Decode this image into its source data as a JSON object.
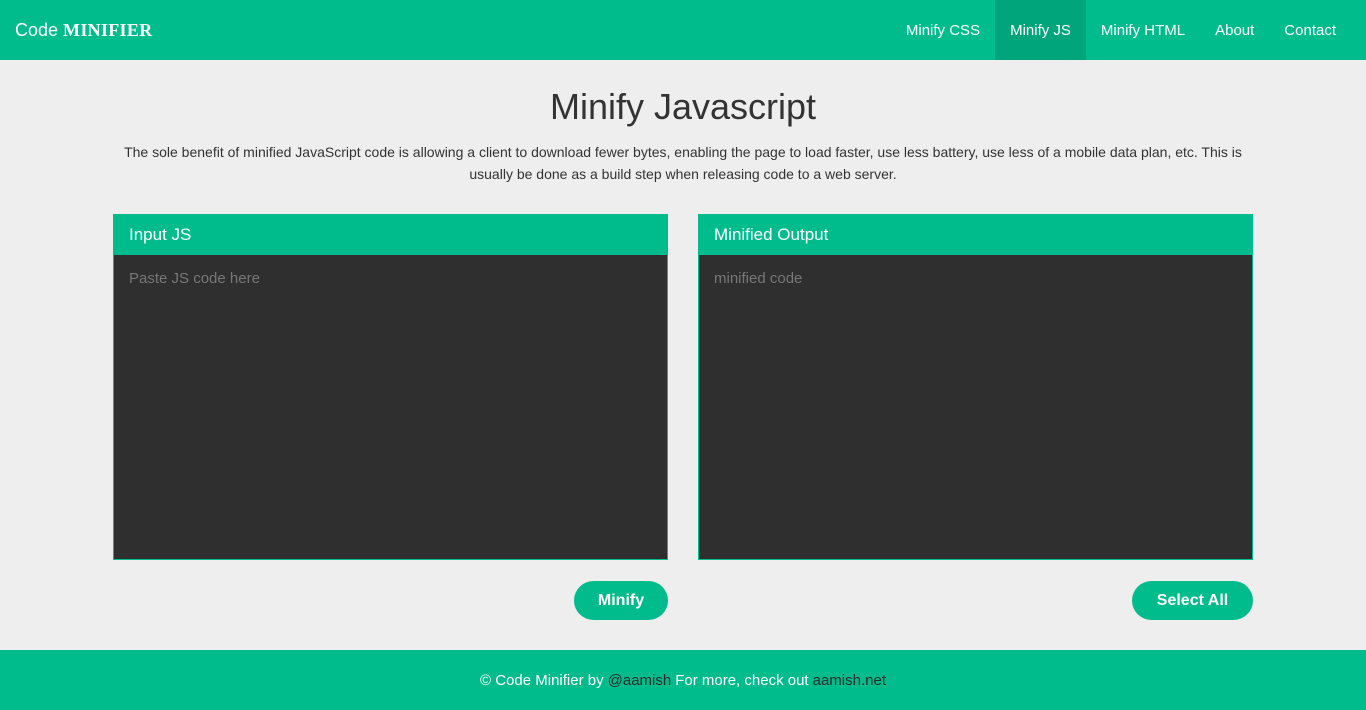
{
  "header": {
    "brand_code": "Code",
    "brand_name": "MINIFIER",
    "nav": [
      {
        "label": "Minify CSS"
      },
      {
        "label": "Minify JS"
      },
      {
        "label": "Minify HTML"
      },
      {
        "label": "About"
      },
      {
        "label": "Contact"
      }
    ],
    "active_nav": "Minify JS"
  },
  "main": {
    "title": "Minify Javascript",
    "description": "The sole benefit of minified JavaScript code is allowing a client to download fewer bytes, enabling the page to load faster, use less battery, use less of a mobile data plan, etc. This is usually be done as a build step when releasing code to a web server.",
    "input_panel": {
      "heading": "Input JS",
      "placeholder": "Paste JS code here",
      "value": ""
    },
    "output_panel": {
      "heading": "Minified Output",
      "placeholder": "minified code",
      "value": ""
    },
    "minify_button": "Minify",
    "select_all_button": "Select All"
  },
  "footer": {
    "copyright": "© Code Minifier by",
    "handle": "@aamish",
    "more_text": "For more, check out",
    "site": "aamish.net"
  },
  "colors": {
    "accent": "#00bc8c",
    "accent_active": "#00a57b",
    "editor_bg": "#2f2f2f",
    "page_bg": "#eeeeee"
  }
}
